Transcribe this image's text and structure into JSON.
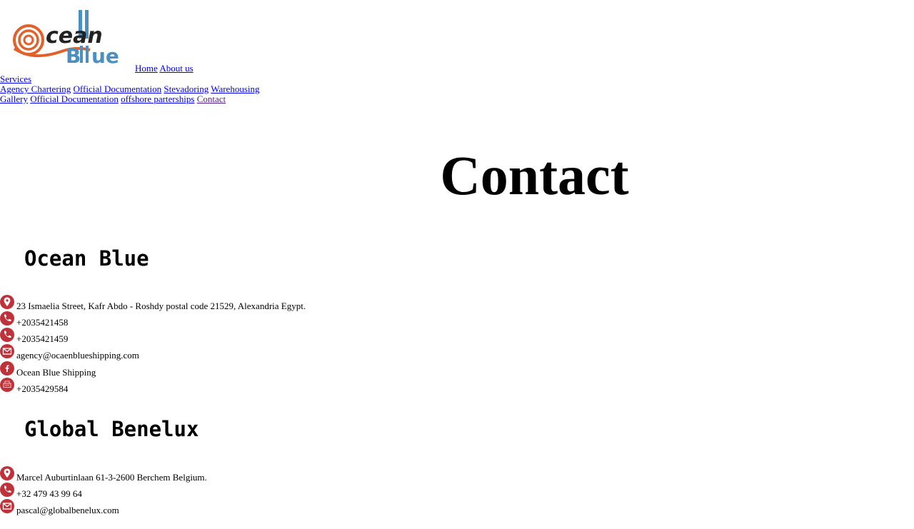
{
  "brand": {
    "logo_text_1": "cean",
    "logo_text_2": "B",
    "logo_text_3": "ue",
    "colors": {
      "orange": "#e2612a",
      "blue": "#4a90c0"
    }
  },
  "nav": {
    "home": "Home",
    "about": "About us",
    "services": "Services",
    "agency_chartering": "Agency Chartering",
    "official_documentation_1": "Official Documentation",
    "stevadoring": "Stevadoring",
    "warehousing": "Warehousing",
    "gallery": "Gallery",
    "official_documentation_2": "Official Documentation",
    "offshore": "offshore parterships",
    "contact": "Contact"
  },
  "page": {
    "title": "Contact"
  },
  "offices": [
    {
      "name": "Ocean Blue",
      "lines": [
        {
          "icon": "location-pin-icon",
          "text": "23 Ismaelia Street, Kafr Abdo - Roshdy postal code 21529, Alexandria Egypt."
        },
        {
          "icon": "phone-icon",
          "text": "+2035421458"
        },
        {
          "icon": "phone-icon",
          "text": "+2035421459"
        },
        {
          "icon": "mail-icon",
          "text": "agency@ocaenblueshipping.com"
        },
        {
          "icon": "facebook-icon",
          "text": "Ocean Blue Shipping"
        },
        {
          "icon": "fax-icon",
          "text": "+2035429584"
        }
      ]
    },
    {
      "name": "Global Benelux",
      "lines": [
        {
          "icon": "location-pin-icon",
          "text": "Marcel Auburtinlaan 61-3-2600 Berchem Belgium."
        },
        {
          "icon": "phone-icon",
          "text": "+32 479 43 99 64"
        },
        {
          "icon": "mail-icon",
          "text": "pascal@globalbenelux.com"
        }
      ]
    }
  ],
  "icon_color": "#c0323a"
}
